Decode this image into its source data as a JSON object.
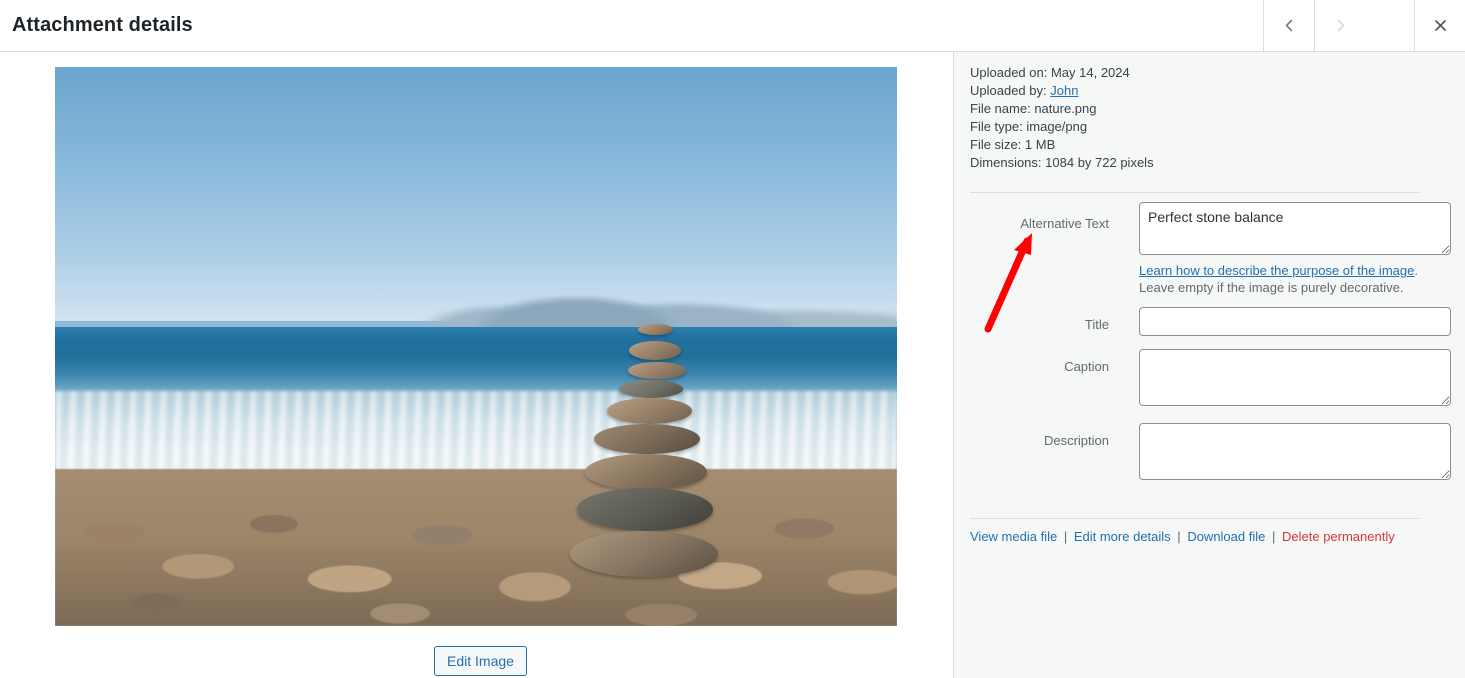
{
  "header": {
    "title": "Attachment details",
    "nav": {
      "prev_icon": "chevron-left-icon",
      "next_icon": "chevron-right-icon",
      "close_icon": "close-icon"
    }
  },
  "preview": {
    "image_alt": "Perfect stone balance",
    "edit_image_label": "Edit Image"
  },
  "sidebar": {
    "meta": {
      "uploaded_on_label": "Uploaded on:",
      "uploaded_on_value": "May 14, 2024",
      "uploaded_by_label": "Uploaded by:",
      "uploaded_by_value": "John",
      "file_name_label": "File name:",
      "file_name_value": "nature.png",
      "file_type_label": "File type:",
      "file_type_value": "image/png",
      "file_size_label": "File size:",
      "file_size_value": "1 MB",
      "dimensions_label": "Dimensions:",
      "dimensions_value": "1084 by 722 pixels"
    },
    "fields": {
      "alt_label": "Alternative Text",
      "alt_value": "Perfect stone balance",
      "alt_placeholder": "",
      "alt_help_link": "Learn how to describe the purpose of the image",
      "alt_help_rest": ". Leave empty if the image is purely decorative.",
      "title_label": "Title",
      "title_value": "",
      "title_placeholder": "",
      "caption_label": "Caption",
      "caption_value": "",
      "caption_placeholder": "",
      "description_label": "Description",
      "description_value": "",
      "description_placeholder": ""
    },
    "actions": {
      "view_media_file": "View media file",
      "edit_more_details": "Edit more details",
      "download_file": "Download file",
      "delete_permanently": "Delete permanently",
      "separator": "|"
    }
  },
  "annotation": {
    "type": "arrow",
    "color": "#ff0000",
    "points_to": "Alternative Text field"
  },
  "colors": {
    "link": "#2271b1",
    "danger": "#d63638",
    "sidebar_bg": "#f6f7f7",
    "border": "#dcdcde",
    "text": "#3c434a",
    "muted": "#646970",
    "annotation": "#ff0000"
  }
}
